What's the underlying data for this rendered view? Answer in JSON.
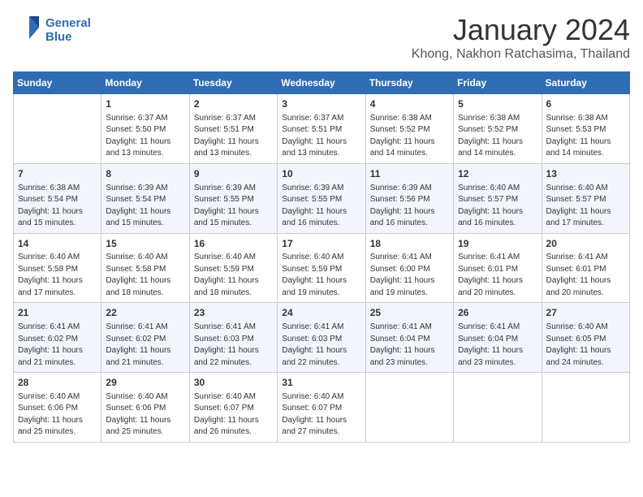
{
  "header": {
    "logo_line1": "General",
    "logo_line2": "Blue",
    "month_title": "January 2024",
    "location": "Khong, Nakhon Ratchasima, Thailand"
  },
  "calendar": {
    "days_of_week": [
      "Sunday",
      "Monday",
      "Tuesday",
      "Wednesday",
      "Thursday",
      "Friday",
      "Saturday"
    ],
    "weeks": [
      [
        {
          "day": "",
          "info": ""
        },
        {
          "day": "1",
          "info": "Sunrise: 6:37 AM\nSunset: 5:50 PM\nDaylight: 11 hours\nand 13 minutes."
        },
        {
          "day": "2",
          "info": "Sunrise: 6:37 AM\nSunset: 5:51 PM\nDaylight: 11 hours\nand 13 minutes."
        },
        {
          "day": "3",
          "info": "Sunrise: 6:37 AM\nSunset: 5:51 PM\nDaylight: 11 hours\nand 13 minutes."
        },
        {
          "day": "4",
          "info": "Sunrise: 6:38 AM\nSunset: 5:52 PM\nDaylight: 11 hours\nand 14 minutes."
        },
        {
          "day": "5",
          "info": "Sunrise: 6:38 AM\nSunset: 5:52 PM\nDaylight: 11 hours\nand 14 minutes."
        },
        {
          "day": "6",
          "info": "Sunrise: 6:38 AM\nSunset: 5:53 PM\nDaylight: 11 hours\nand 14 minutes."
        }
      ],
      [
        {
          "day": "7",
          "info": "Sunrise: 6:38 AM\nSunset: 5:54 PM\nDaylight: 11 hours\nand 15 minutes."
        },
        {
          "day": "8",
          "info": "Sunrise: 6:39 AM\nSunset: 5:54 PM\nDaylight: 11 hours\nand 15 minutes."
        },
        {
          "day": "9",
          "info": "Sunrise: 6:39 AM\nSunset: 5:55 PM\nDaylight: 11 hours\nand 15 minutes."
        },
        {
          "day": "10",
          "info": "Sunrise: 6:39 AM\nSunset: 5:55 PM\nDaylight: 11 hours\nand 16 minutes."
        },
        {
          "day": "11",
          "info": "Sunrise: 6:39 AM\nSunset: 5:56 PM\nDaylight: 11 hours\nand 16 minutes."
        },
        {
          "day": "12",
          "info": "Sunrise: 6:40 AM\nSunset: 5:57 PM\nDaylight: 11 hours\nand 16 minutes."
        },
        {
          "day": "13",
          "info": "Sunrise: 6:40 AM\nSunset: 5:57 PM\nDaylight: 11 hours\nand 17 minutes."
        }
      ],
      [
        {
          "day": "14",
          "info": "Sunrise: 6:40 AM\nSunset: 5:58 PM\nDaylight: 11 hours\nand 17 minutes."
        },
        {
          "day": "15",
          "info": "Sunrise: 6:40 AM\nSunset: 5:58 PM\nDaylight: 11 hours\nand 18 minutes."
        },
        {
          "day": "16",
          "info": "Sunrise: 6:40 AM\nSunset: 5:59 PM\nDaylight: 11 hours\nand 18 minutes."
        },
        {
          "day": "17",
          "info": "Sunrise: 6:40 AM\nSunset: 5:59 PM\nDaylight: 11 hours\nand 19 minutes."
        },
        {
          "day": "18",
          "info": "Sunrise: 6:41 AM\nSunset: 6:00 PM\nDaylight: 11 hours\nand 19 minutes."
        },
        {
          "day": "19",
          "info": "Sunrise: 6:41 AM\nSunset: 6:01 PM\nDaylight: 11 hours\nand 20 minutes."
        },
        {
          "day": "20",
          "info": "Sunrise: 6:41 AM\nSunset: 6:01 PM\nDaylight: 11 hours\nand 20 minutes."
        }
      ],
      [
        {
          "day": "21",
          "info": "Sunrise: 6:41 AM\nSunset: 6:02 PM\nDaylight: 11 hours\nand 21 minutes."
        },
        {
          "day": "22",
          "info": "Sunrise: 6:41 AM\nSunset: 6:02 PM\nDaylight: 11 hours\nand 21 minutes."
        },
        {
          "day": "23",
          "info": "Sunrise: 6:41 AM\nSunset: 6:03 PM\nDaylight: 11 hours\nand 22 minutes."
        },
        {
          "day": "24",
          "info": "Sunrise: 6:41 AM\nSunset: 6:03 PM\nDaylight: 11 hours\nand 22 minutes."
        },
        {
          "day": "25",
          "info": "Sunrise: 6:41 AM\nSunset: 6:04 PM\nDaylight: 11 hours\nand 23 minutes."
        },
        {
          "day": "26",
          "info": "Sunrise: 6:41 AM\nSunset: 6:04 PM\nDaylight: 11 hours\nand 23 minutes."
        },
        {
          "day": "27",
          "info": "Sunrise: 6:40 AM\nSunset: 6:05 PM\nDaylight: 11 hours\nand 24 minutes."
        }
      ],
      [
        {
          "day": "28",
          "info": "Sunrise: 6:40 AM\nSunset: 6:06 PM\nDaylight: 11 hours\nand 25 minutes."
        },
        {
          "day": "29",
          "info": "Sunrise: 6:40 AM\nSunset: 6:06 PM\nDaylight: 11 hours\nand 25 minutes."
        },
        {
          "day": "30",
          "info": "Sunrise: 6:40 AM\nSunset: 6:07 PM\nDaylight: 11 hours\nand 26 minutes."
        },
        {
          "day": "31",
          "info": "Sunrise: 6:40 AM\nSunset: 6:07 PM\nDaylight: 11 hours\nand 27 minutes."
        },
        {
          "day": "",
          "info": ""
        },
        {
          "day": "",
          "info": ""
        },
        {
          "day": "",
          "info": ""
        }
      ]
    ]
  }
}
